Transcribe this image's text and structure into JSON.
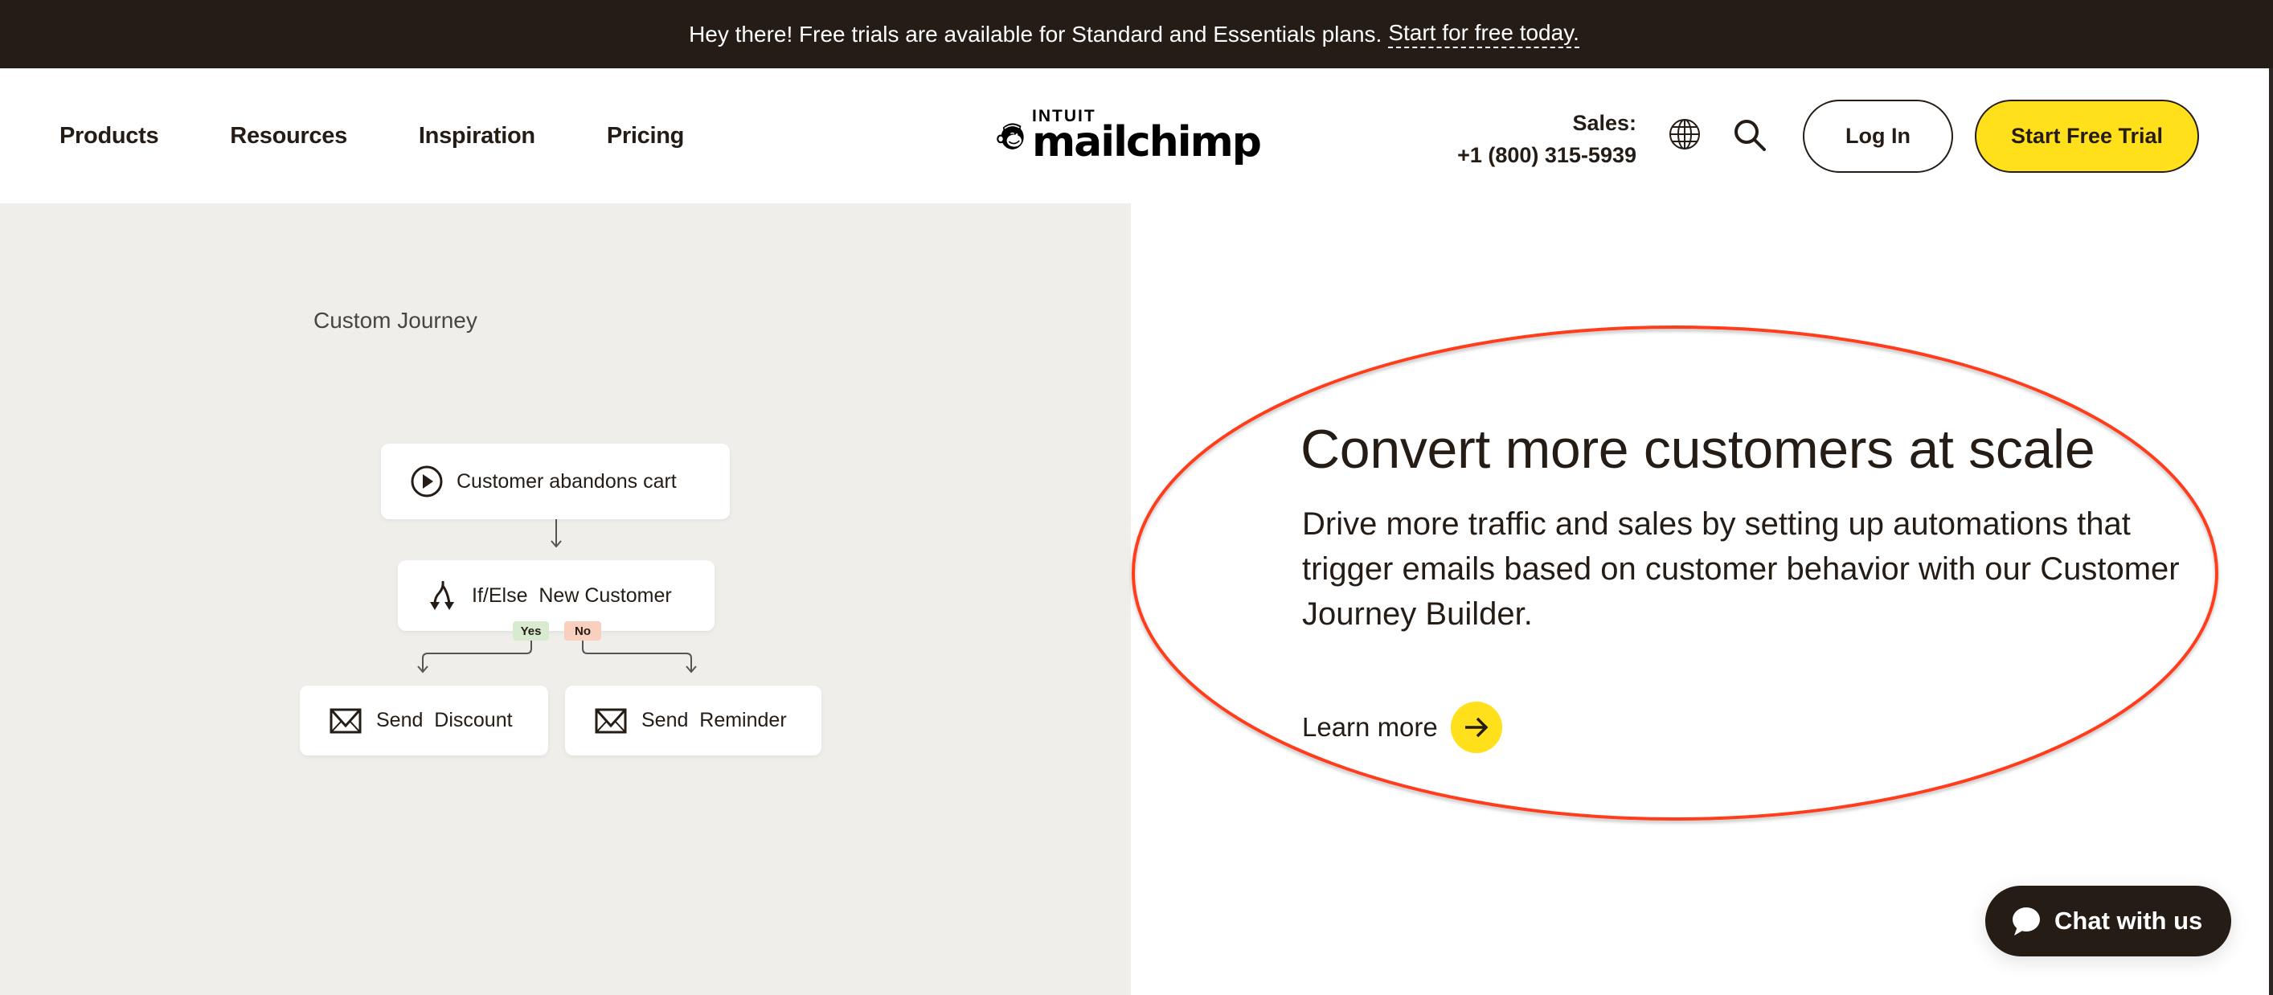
{
  "banner": {
    "message": "Hey there! Free trials are available for Standard and Essentials plans.",
    "link_label": "Start for free today."
  },
  "nav": {
    "items": [
      {
        "label": "Products"
      },
      {
        "label": "Resources"
      },
      {
        "label": "Inspiration"
      },
      {
        "label": "Pricing"
      }
    ],
    "logo": {
      "top_word": "INTUIT",
      "brand": "mailchimp",
      "icon": "freddie-monkey-logo"
    },
    "sales": {
      "label": "Sales:",
      "phone": "+1 (800) 315-5939"
    },
    "icons": {
      "language": "globe-icon",
      "search": "search-icon"
    },
    "login_label": "Log In",
    "trial_label": "Start Free Trial"
  },
  "journey": {
    "title": "Custom Journey",
    "steps": [
      {
        "icon": "play-circle-icon",
        "label": "Customer abandons cart"
      },
      {
        "icon": "split-arrows-icon",
        "label": "If/Else  New Customer"
      },
      {
        "icon": "envelope-icon",
        "label": "Send  Discount"
      },
      {
        "icon": "envelope-icon",
        "label": "Send  Reminder"
      }
    ],
    "branches": {
      "yes": "Yes",
      "no": "No"
    }
  },
  "feature": {
    "headline": "Convert more customers at scale",
    "description": "Drive more traffic and sales by setting up automations that trigger emails based on customer behavior with our Customer Journey Builder.",
    "learn_more": "Learn more"
  },
  "chat": {
    "label": "Chat with us"
  },
  "colors": {
    "brand_dark": "#241c15",
    "brand_yellow": "#ffe01b",
    "panel_bg": "#efeeea",
    "yes_badge": "#d8ebcf",
    "no_badge": "#f9cfbd",
    "annotation_ellipse": "#ff3d1a"
  }
}
